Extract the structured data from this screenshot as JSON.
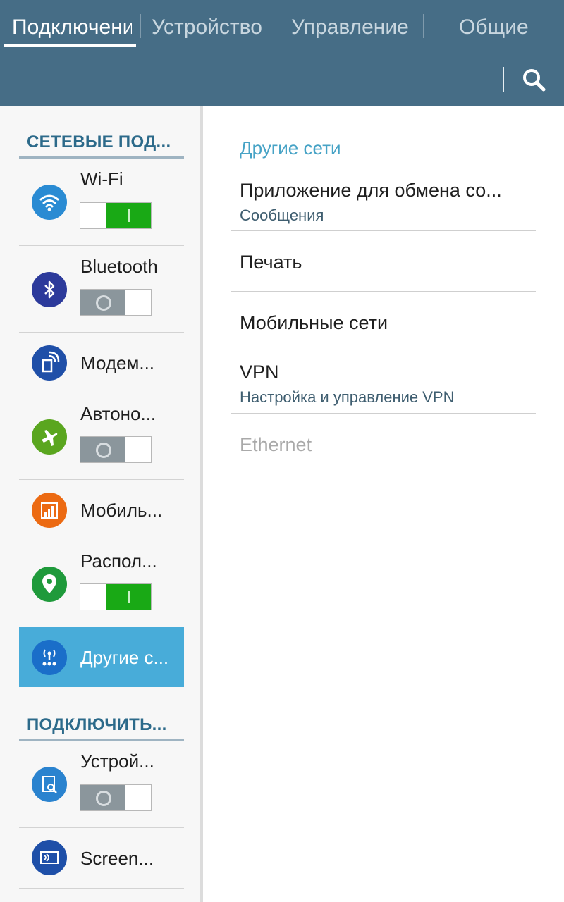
{
  "tabs": [
    {
      "label": "Подключени"
    },
    {
      "label": "Устройство"
    },
    {
      "label": "Управление"
    },
    {
      "label": "Общие"
    }
  ],
  "search_icon": "search-icon",
  "sidebar": {
    "section1": "СЕТЕВЫЕ ПОД...",
    "section2": "ПОДКЛЮЧИТЬ...",
    "items": [
      {
        "label": "Wi-Fi",
        "icon": "wifi-icon",
        "color": "#2a8bd3",
        "switch": "on"
      },
      {
        "label": "Bluetooth",
        "icon": "bluetooth-icon",
        "color": "#2c3a9b",
        "switch": "off"
      },
      {
        "label": "Модем...",
        "icon": "tethering-icon",
        "color": "#1f4fa8"
      },
      {
        "label": "Автоно...",
        "icon": "airplane-icon",
        "color": "#5aa61f",
        "switch": "off"
      },
      {
        "label": "Мобиль...",
        "icon": "data-usage-icon",
        "color": "#ec6a12"
      },
      {
        "label": "Распол...",
        "icon": "location-icon",
        "color": "#1f9a3b",
        "switch": "on"
      },
      {
        "label": "Другие с...",
        "icon": "more-networks-icon",
        "color": "#1a6ec9",
        "selected": true
      },
      {
        "label": "Устрой...",
        "icon": "nearby-devices-icon",
        "color": "#2a83cf",
        "switch": "off"
      },
      {
        "label": "Screen...",
        "icon": "screen-mirroring-icon",
        "color": "#1e4fa8"
      }
    ]
  },
  "content": {
    "header": "Другие сети",
    "items": [
      {
        "title": "Приложение для обмена со...",
        "subtitle": "Сообщения"
      },
      {
        "title": "Печать"
      },
      {
        "title": "Мобильные сети"
      },
      {
        "title": "VPN",
        "subtitle": "Настройка и управление VPN"
      },
      {
        "title": "Ethernet",
        "disabled": true
      }
    ]
  }
}
